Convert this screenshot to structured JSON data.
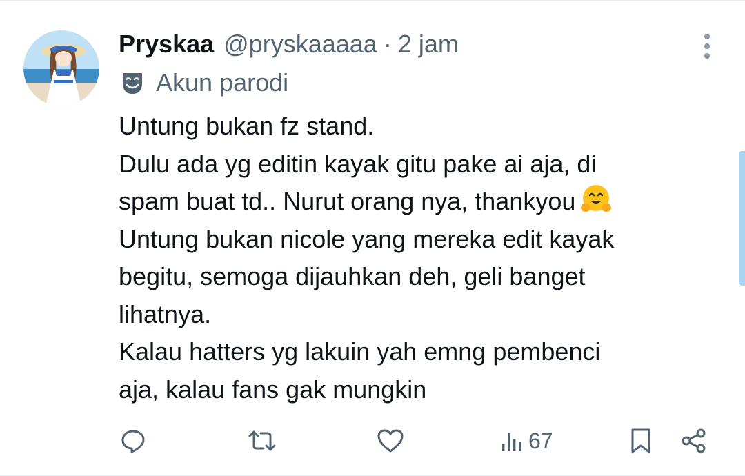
{
  "author": {
    "display_name": "Pryskaa",
    "handle": "@pryskaaaaa",
    "separator": "·",
    "time": "2 jam",
    "label": "Akun parodi",
    "label_icon": "theater-mask-icon",
    "avatar": "anime-girl-beach-avatar"
  },
  "tweet": {
    "lines": [
      "Untung bukan fz stand.",
      "Dulu ada yg editin kayak gitu pake ai aja, di",
      "spam buat td.. Nurut orang nya, thankyou",
      "Untung bukan nicole yang mereka edit kayak",
      "begitu, semoga dijauhkan deh, geli banget",
      "lihatnya.",
      "Kalau hatters yg lakuin yah emng pembenci",
      "aja, kalau fans gak mungkin"
    ],
    "emoji": "hugging-face-emoji"
  },
  "actions": {
    "reply_icon": "reply-icon",
    "retweet_icon": "retweet-icon",
    "like_icon": "heart-icon",
    "views_icon": "views-icon",
    "views_count": "67",
    "bookmark_icon": "bookmark-icon",
    "share_icon": "share-icon"
  },
  "colors": {
    "text_primary": "#0f1419",
    "text_secondary": "#536471",
    "scrollbar": "#a8d4f5"
  }
}
